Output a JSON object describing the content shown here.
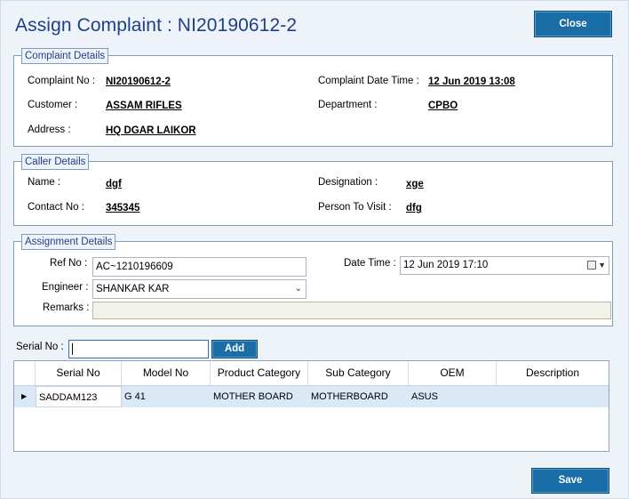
{
  "dialog": {
    "title": "Assign Complaint : NI20190612-2",
    "close_label": "Close",
    "save_label": "Save"
  },
  "complaint_details": {
    "legend": "Complaint Details",
    "complaint_no_label": "Complaint No :",
    "complaint_no": "NI20190612-2",
    "customer_label": "Customer :",
    "customer": "ASSAM RIFLES",
    "address_label": "Address :",
    "address": "HQ DGAR LAIKOR",
    "datetime_label": "Complaint Date Time :",
    "datetime": "12 Jun 2019 13:08",
    "department_label": "Department :",
    "department": "CPBO"
  },
  "caller_details": {
    "legend": "Caller Details",
    "name_label": "Name :",
    "name": "dgf",
    "contact_label": "Contact No :",
    "contact": "345345",
    "designation_label": "Designation :",
    "designation": "xge",
    "person_label": "Person To Visit :",
    "person": "dfg"
  },
  "assignment_details": {
    "legend": "Assignment Details",
    "ref_no_label": "Ref No :",
    "ref_no": "AC~1210196609",
    "engineer_label": "Engineer :",
    "engineer": "SHANKAR KAR",
    "remarks_label": "Remarks :",
    "remarks": "",
    "datetime_label": "Date Time :",
    "datetime": "12 Jun  2019 17:10"
  },
  "serial": {
    "label": "Serial No :",
    "value": "",
    "add_label": "Add"
  },
  "grid": {
    "columns": [
      "Serial No",
      "Model No",
      "Product Category",
      "Sub Category",
      "OEM",
      "Description"
    ],
    "rows": [
      [
        "SADDAM123",
        "G 41",
        "MOTHER BOARD",
        "MOTHERBOARD",
        "ASUS",
        ""
      ]
    ]
  },
  "colors": {
    "title": "#1f3f88",
    "button": "#1a6ea8",
    "selected_row": "#dbe9f6"
  }
}
